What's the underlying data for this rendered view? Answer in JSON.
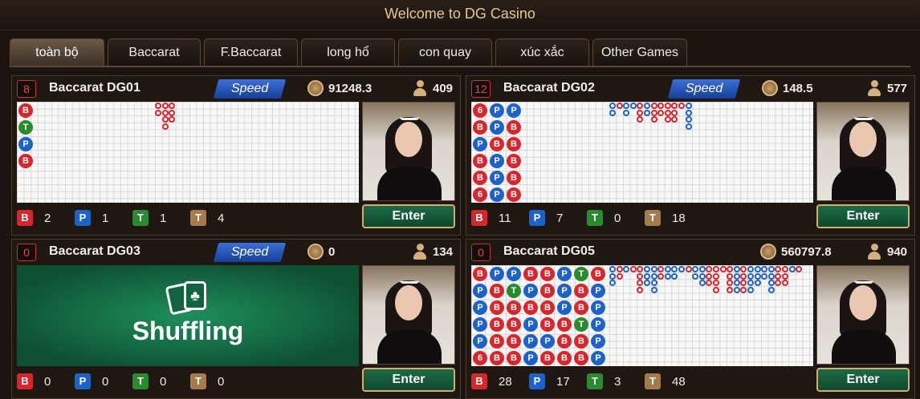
{
  "header": {
    "title": "Welcome to DG Casino"
  },
  "tabs": [
    {
      "label": "toàn bộ",
      "active": true
    },
    {
      "label": "Baccarat"
    },
    {
      "label": "F.Baccarat"
    },
    {
      "label": "long hổ"
    },
    {
      "label": "con quay"
    },
    {
      "label": "xúc xắc"
    },
    {
      "label": "Other Games"
    }
  ],
  "tables": [
    {
      "name": "Baccarat DG01",
      "round": "8",
      "speed": "Speed",
      "balance": "91248.3",
      "players": "409",
      "enter": "Enter",
      "bead": [
        "B",
        "T",
        "P",
        "B"
      ],
      "stats": {
        "B": "2",
        "P": "1",
        "T": "1",
        "TT": "4"
      }
    },
    {
      "name": "Baccarat DG02",
      "round": "12",
      "speed": "Speed",
      "balance": "148.5",
      "players": "577",
      "enter": "Enter",
      "bead": [
        "6",
        "B",
        "P",
        "B",
        "B",
        "6",
        "P",
        "P",
        "B",
        "P",
        "P",
        "P",
        "P",
        "B",
        "B",
        "B",
        "B",
        "B"
      ],
      "stats": {
        "B": "11",
        "P": "7",
        "T": "0",
        "TT": "18"
      }
    },
    {
      "name": "Baccarat DG03",
      "round": "0",
      "speed": "Speed",
      "balance": "0",
      "players": "134",
      "enter": "Enter",
      "shuffling": "Shuffling",
      "stats": {
        "B": "0",
        "P": "0",
        "T": "0",
        "TT": "0"
      }
    },
    {
      "name": "Baccarat DG05",
      "round": "0",
      "speed": "",
      "balance": "560797.8",
      "players": "940",
      "enter": "Enter",
      "bead": [
        "B",
        "P",
        "P",
        "P",
        "P",
        "6",
        "P",
        "B",
        "B",
        "B",
        "B",
        "B",
        "P",
        "T",
        "B",
        "B",
        "B",
        "B",
        "B",
        "P",
        "B",
        "P",
        "P",
        "P",
        "B",
        "B",
        "B",
        "B",
        "P",
        "B",
        "P",
        "P",
        "P",
        "B",
        "B",
        "B",
        "T",
        "B",
        "B",
        "T",
        "B",
        "B",
        "B",
        "P",
        "P",
        "P",
        "P",
        "P"
      ],
      "stats": {
        "B": "28",
        "P": "17",
        "T": "3",
        "TT": "48"
      }
    }
  ],
  "badge_letters": {
    "B": "B",
    "P": "P",
    "T": "T",
    "TT": "T"
  },
  "colors": {
    "banker": "#d7262c",
    "player": "#1d62c9",
    "tie": "#2a8a2e",
    "gold": "#d2ae6a"
  }
}
